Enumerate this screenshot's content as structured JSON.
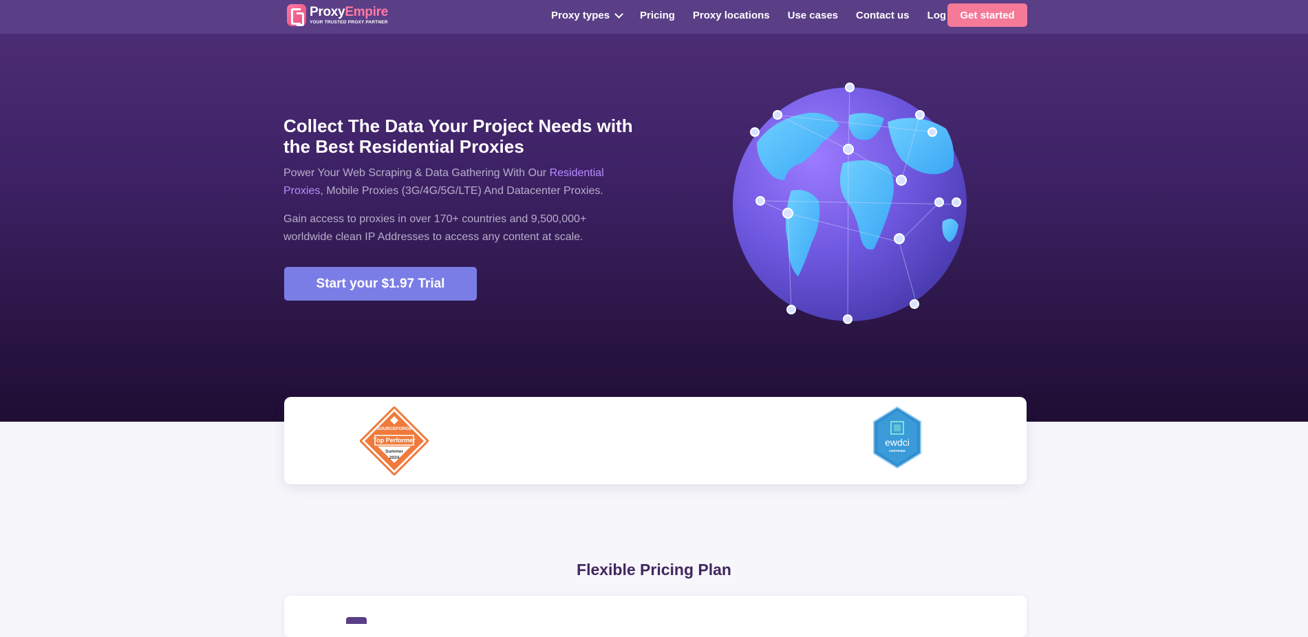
{
  "nav": {
    "logo_name_part1": "Proxy",
    "logo_name_part2": "Empire",
    "logo_tagline": "YOUR TRUSTED PROXY PARTNER",
    "links": [
      "Proxy types",
      "Pricing",
      "Proxy locations",
      "Use cases",
      "Contact us",
      "Log in"
    ],
    "cta": "Get started"
  },
  "hero": {
    "title": "Collect The Data Your Project Needs with the Best Residential Proxies",
    "subtitle_before": "Power Your Web Scraping & Data Gathering With Our ",
    "subtitle_link": "Residential Proxies",
    "subtitle_after": ", Mobile Proxies (3G/4G/5G/LTE) And Datacenter Proxies.",
    "subtitle2": "Gain access to proxies in over 170+ countries and 9,500,000+ worldwide clean IP Addresses to access any content at scale.",
    "cta": "Start your $1.97 Trial"
  },
  "badges": {
    "sourceforge": {
      "brand": "SOURCEFORGE",
      "title": "Top Performer",
      "season": "Summer",
      "year": "2024"
    },
    "ewdci": {
      "name": "ewdci",
      "sub": "CERTIFIED"
    }
  },
  "pricing": {
    "title": "Flexible Pricing Plan"
  },
  "colors": {
    "accent_pink": "#f47a97",
    "button_blue": "#7b7de6",
    "hero_bg": "#3e2266",
    "link_purple": "#b88cff"
  }
}
